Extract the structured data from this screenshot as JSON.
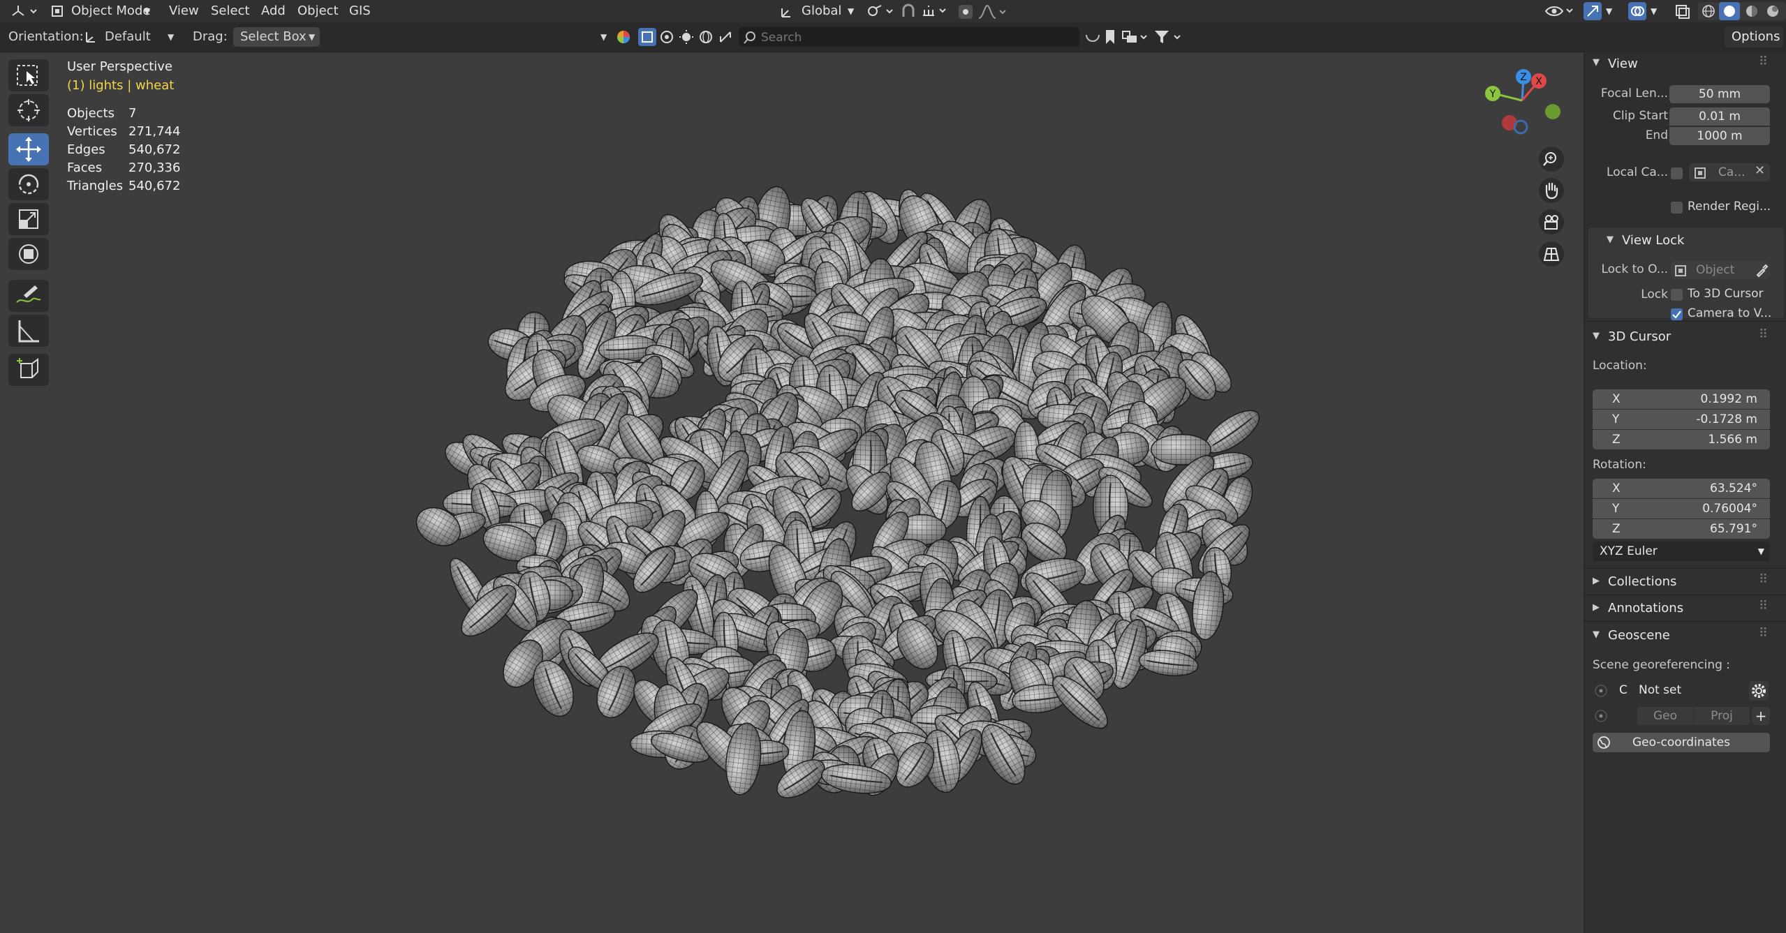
{
  "header": {
    "mode": "Object Mode",
    "menu": [
      "View",
      "Select",
      "Add",
      "Object",
      "GIS"
    ],
    "transform_orientation": "Global",
    "options_label": "Options"
  },
  "toolbar": {
    "orientation_label": "Orientation:",
    "orientation_value": "Default",
    "drag_label": "Drag:",
    "drag_value": "Select Box",
    "search_placeholder": "Search"
  },
  "viewport": {
    "view_name": "User Perspective",
    "collection_info": "(1) lights | wheat",
    "stats": [
      {
        "label": "Objects",
        "value": "7"
      },
      {
        "label": "Vertices",
        "value": "271,744"
      },
      {
        "label": "Edges",
        "value": "540,672"
      },
      {
        "label": "Faces",
        "value": "270,336"
      },
      {
        "label": "Triangles",
        "value": "540,672"
      }
    ],
    "gizmo_axes": {
      "x": "X",
      "y": "Y",
      "z": "Z"
    }
  },
  "panel": {
    "view": {
      "title": "View",
      "focal_length_label": "Focal Len...",
      "focal_length": "50 mm",
      "clip_start_label": "Clip Start",
      "clip_start": "0.01 m",
      "end_label": "End",
      "end": "1000 m",
      "local_camera_label": "Local Ca...",
      "local_camera_value": "Ca...",
      "render_region_label": "Render Regi..."
    },
    "view_lock": {
      "title": "View Lock",
      "lock_to_object_label": "Lock to O...",
      "lock_to_object_placeholder": "Object",
      "lock_label": "Lock",
      "to_3d_cursor_label": "To 3D Cursor",
      "camera_to_view_label": "Camera to V..."
    },
    "cursor": {
      "title": "3D Cursor",
      "location_label": "Location:",
      "location": [
        {
          "axis": "X",
          "value": "0.1992 m"
        },
        {
          "axis": "Y",
          "value": "-0.1728 m"
        },
        {
          "axis": "Z",
          "value": "1.566 m"
        }
      ],
      "rotation_label": "Rotation:",
      "rotation": [
        {
          "axis": "X",
          "value": "63.524°"
        },
        {
          "axis": "Y",
          "value": "0.76004°"
        },
        {
          "axis": "Z",
          "value": "65.791°"
        }
      ],
      "rotation_mode": "XYZ Euler"
    },
    "collections_title": "Collections",
    "annotations_title": "Annotations",
    "geoscene": {
      "title": "Geoscene",
      "georef_label": "Scene georeferencing :",
      "crs_prefix": "C",
      "crs_value": "Not set",
      "geo_button": "Geo",
      "proj_button": "Proj",
      "geocoords_button": "Geo-coordinates"
    }
  },
  "colors": {
    "accent": "#4772b3",
    "viewport_bg": "#3d3d3d",
    "panel_bg": "#303030",
    "highlight_text": "#f2d64a",
    "axis_x": "#e04848",
    "axis_y": "#8cc63f",
    "axis_z": "#3a8ee6"
  }
}
